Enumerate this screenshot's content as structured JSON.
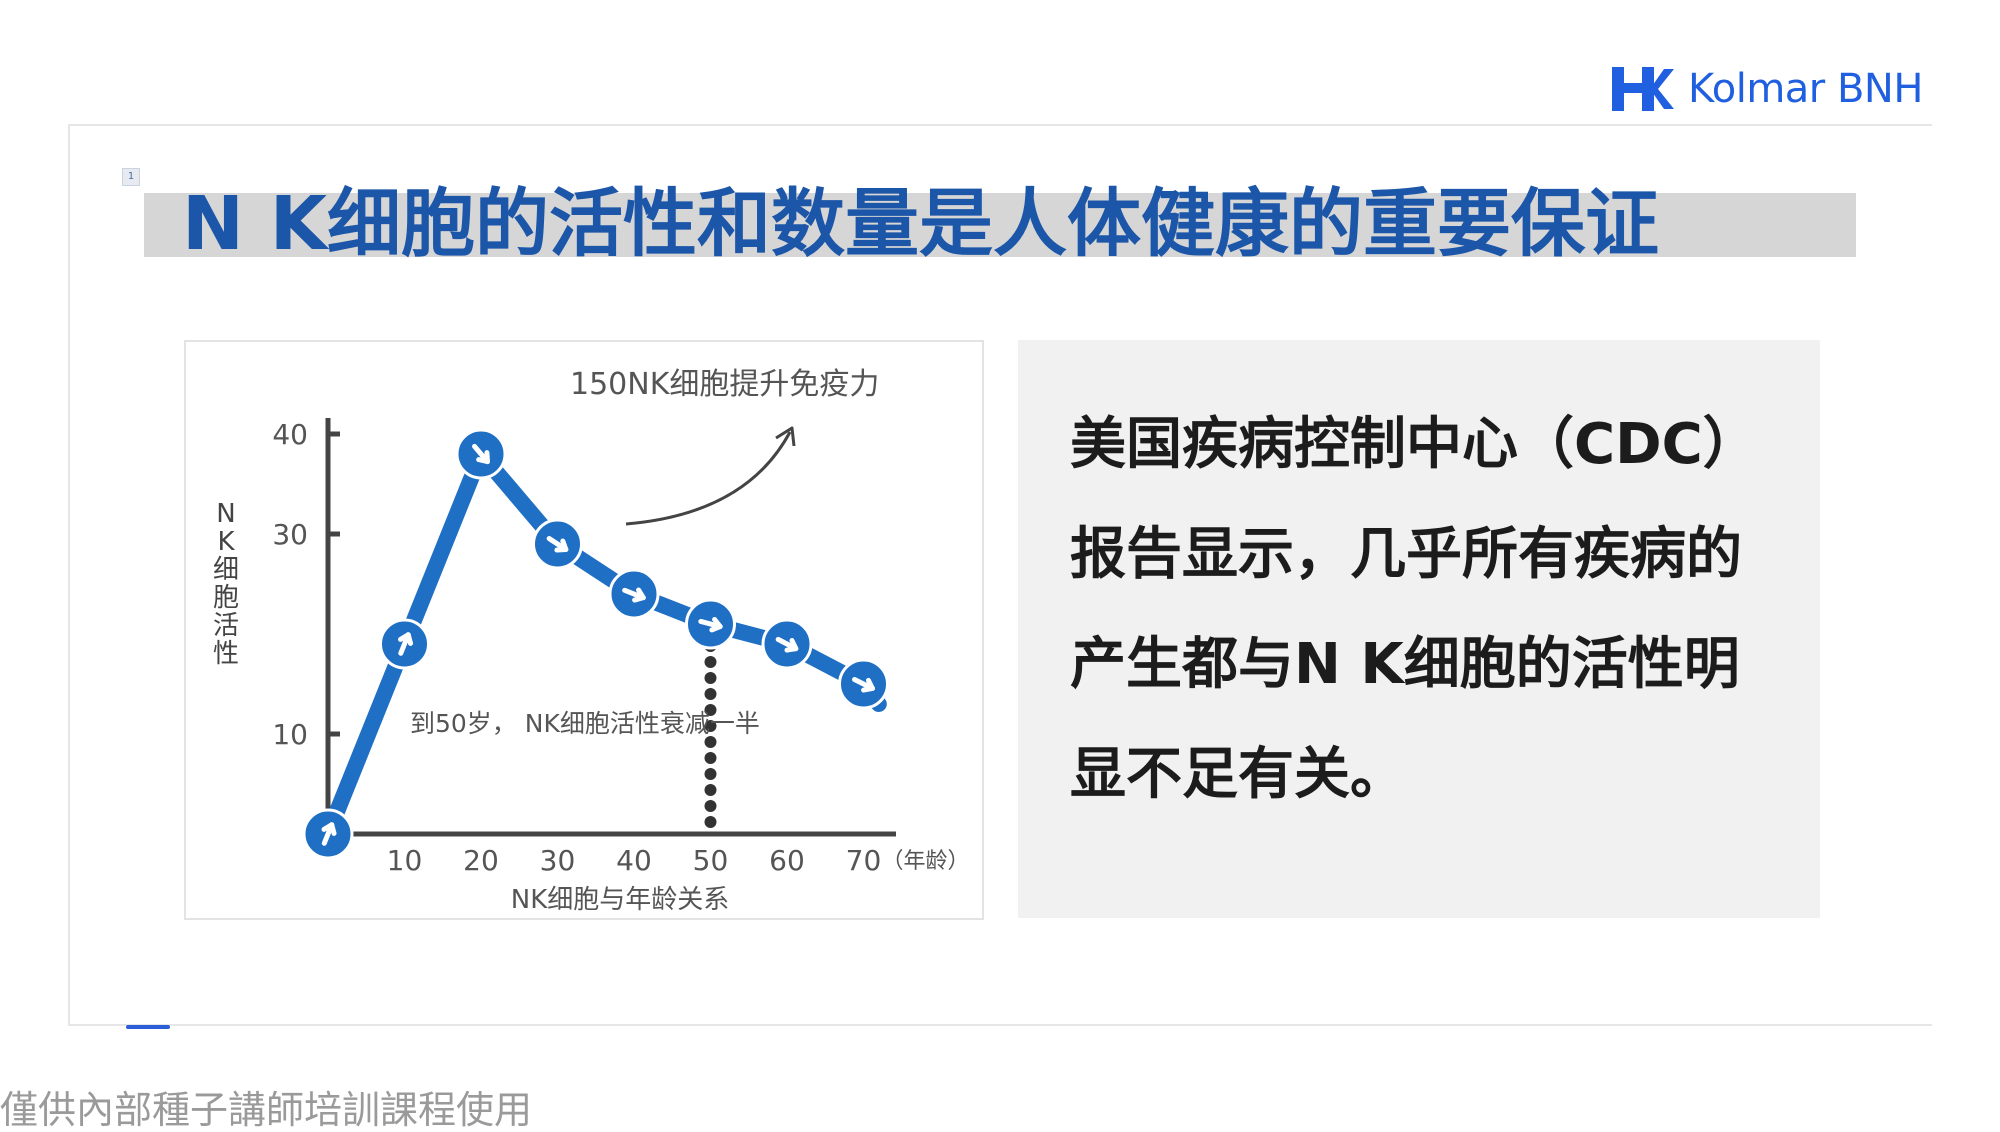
{
  "brand": {
    "name": "Kolmar BNH",
    "color": "#1f5fe0"
  },
  "slide": {
    "badge": "1",
    "title": "N K细胞的活性和数量是人体健康的重要保证",
    "title_color": "#1b56a8",
    "body_text": "美国疾病控制中心（CDC）报告显示，几乎所有疾病的产生都与N K细胞的活性明显不足有关。"
  },
  "chart_data": {
    "type": "line",
    "title": "NK细胞与年龄关系",
    "ylabel": "N K 细胞活性",
    "xlabel_unit": "（年龄）",
    "x_ticks": [
      10,
      20,
      30,
      40,
      50,
      60,
      70
    ],
    "y_ticks": [
      10,
      30,
      40
    ],
    "xlim": [
      0,
      75
    ],
    "ylim": [
      0,
      40
    ],
    "x": [
      0,
      10,
      20,
      30,
      40,
      50,
      60,
      70,
      72
    ],
    "y": [
      0,
      19,
      38,
      29,
      24,
      21,
      19,
      15,
      13
    ],
    "line_color": "#1f6fc5",
    "annotations": {
      "arrow_note": "150NK细胞提升免疫力",
      "midlife_note": "到50岁， NK细胞活性衰减一半",
      "marker_age": 50
    }
  },
  "footer": {
    "note": "僅供內部種子講師培訓課程使用"
  }
}
